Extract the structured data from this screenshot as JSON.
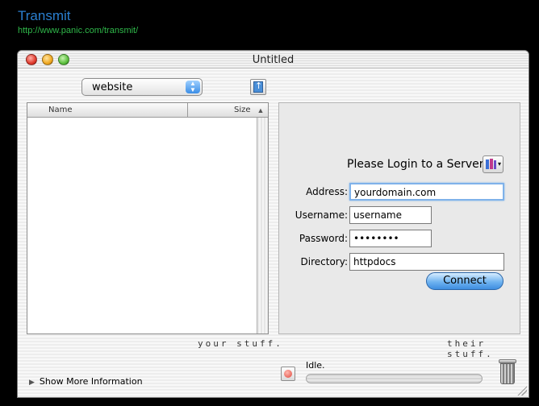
{
  "banner": {
    "title": "Transmit",
    "url": "http://www.panic.com/transmit/"
  },
  "window": {
    "title": "Untitled"
  },
  "toolbar": {
    "site_select_value": "website"
  },
  "file_list": {
    "columns": [
      "Name",
      "Size"
    ],
    "sort_indicator": "▲"
  },
  "labels": {
    "left": "your stuff.",
    "right": "their stuff."
  },
  "login": {
    "heading": "Please Login to a Server",
    "fields": {
      "address": {
        "label": "Address:",
        "value": "yourdomain.com"
      },
      "username": {
        "label": "Username:",
        "value": "username"
      },
      "password": {
        "label": "Password:",
        "value": "••••••••"
      },
      "directory": {
        "label": "Directory:",
        "value": "httpdocs"
      }
    },
    "connect_label": "Connect"
  },
  "statusbar": {
    "show_more_label": "Show More Information",
    "status": "Idle."
  },
  "icons": {
    "close": "close-button-icon",
    "minimize": "minimize-button-icon",
    "zoom": "zoom-button-icon",
    "upload": "upload-icon",
    "favorites": "books-icon",
    "stop": "stop-icon",
    "trash": "trash-icon"
  }
}
